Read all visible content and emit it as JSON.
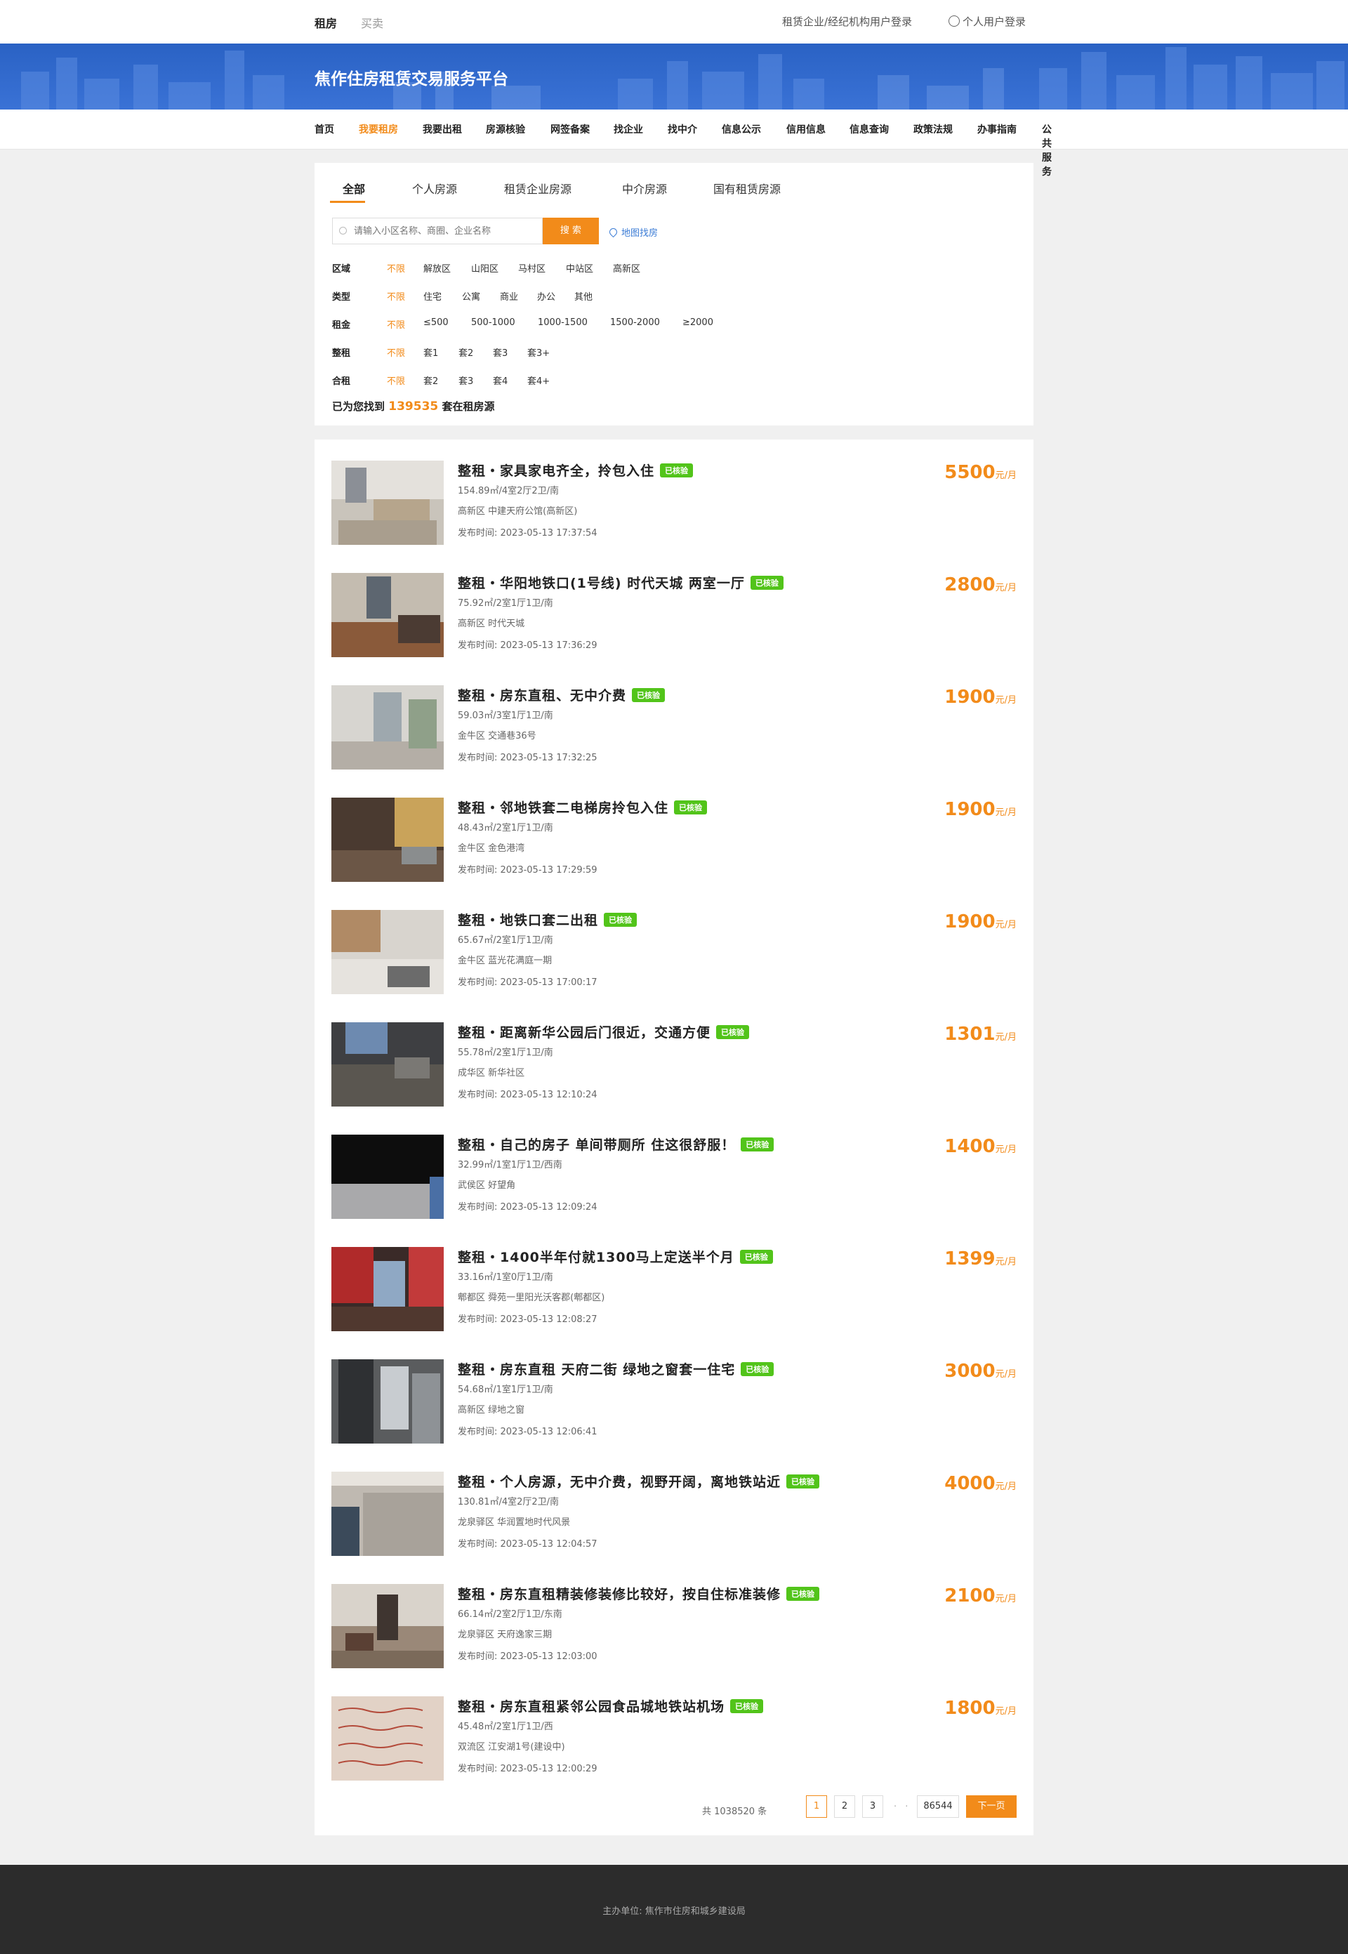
{
  "topbar": {
    "tabs": [
      "租房",
      "买卖"
    ],
    "company_login": "租赁企业/经纪机构用户登录",
    "personal_login": "个人用户登录"
  },
  "banner": {
    "title": "焦作住房租赁交易服务平台"
  },
  "nav": {
    "items": [
      "首页",
      "我要租房",
      "我要出租",
      "房源核验",
      "网签备案",
      "找企业",
      "找中介",
      "信息公示",
      "信用信息",
      "信息查询",
      "政策法规",
      "办事指南",
      "公共服务"
    ],
    "active": "我要租房"
  },
  "filter": {
    "tabs": [
      "全部",
      "个人房源",
      "租赁企业房源",
      "中介房源",
      "国有租赁房源"
    ],
    "active_tab": "全部",
    "search_placeholder": "请输入小区名称、商圈、企业名称",
    "search_button": "搜 索",
    "map_link": "地图找房",
    "rows": [
      {
        "label": "区域",
        "options": [
          "不限",
          "解放区",
          "山阳区",
          "马村区",
          "中站区",
          "高新区"
        ]
      },
      {
        "label": "类型",
        "options": [
          "不限",
          "住宅",
          "公寓",
          "商业",
          "办公",
          "其他"
        ]
      },
      {
        "label": "租金",
        "options": [
          "不限",
          "≤500",
          "500-1000",
          "1000-1500",
          "1500-2000",
          "≥2000"
        ]
      },
      {
        "label": "整租",
        "options": [
          "不限",
          "套1",
          "套2",
          "套3",
          "套3+"
        ]
      },
      {
        "label": "合租",
        "options": [
          "不限",
          "套2",
          "套3",
          "套4",
          "套4+"
        ]
      }
    ],
    "selected": "不限",
    "result_prefix": "已为您找到",
    "result_count": "139535",
    "result_suffix": "套在租房源"
  },
  "listings": [
    {
      "title": "整租・家具家电齐全，拎包入住",
      "badge": "已核验",
      "spec": "154.89㎡/4室2厅2卫/南",
      "location": "高新区 中建天府公馆(高新区)",
      "time": "发布时间: 2023-05-13 17:37:54",
      "price": "5500",
      "unit": "元/月"
    },
    {
      "title": "整租・华阳地铁口(1号线) 时代天城 两室一厅",
      "badge": "已核验",
      "spec": "75.92㎡/2室1厅1卫/南",
      "location": "高新区 时代天城",
      "time": "发布时间: 2023-05-13 17:36:29",
      "price": "2800",
      "unit": "元/月"
    },
    {
      "title": "整租・房东直租、无中介费",
      "badge": "已核验",
      "spec": "59.03㎡/3室1厅1卫/南",
      "location": "金牛区 交通巷36号",
      "time": "发布时间: 2023-05-13 17:32:25",
      "price": "1900",
      "unit": "元/月"
    },
    {
      "title": "整租・邻地铁套二电梯房拎包入住",
      "badge": "已核验",
      "spec": "48.43㎡/2室1厅1卫/南",
      "location": "金牛区 金色港湾",
      "time": "发布时间: 2023-05-13 17:29:59",
      "price": "1900",
      "unit": "元/月"
    },
    {
      "title": "整租・地铁口套二出租",
      "badge": "已核验",
      "spec": "65.67㎡/2室1厅1卫/南",
      "location": "金牛区 蓝光花满庭一期",
      "time": "发布时间: 2023-05-13 17:00:17",
      "price": "1900",
      "unit": "元/月"
    },
    {
      "title": "整租・距离新华公园后门很近，交通方便",
      "badge": "已核验",
      "spec": "55.78㎡/2室1厅1卫/南",
      "location": "成华区 新华社区",
      "time": "发布时间: 2023-05-13 12:10:24",
      "price": "1301",
      "unit": "元/月"
    },
    {
      "title": "整租・自己的房子 单间带厕所 住这很舒服！",
      "badge": "已核验",
      "spec": "32.99㎡/1室1厅1卫/西南",
      "location": "武侯区 好望角",
      "time": "发布时间: 2023-05-13 12:09:24",
      "price": "1400",
      "unit": "元/月"
    },
    {
      "title": "整租・1400半年付就1300马上定送半个月",
      "badge": "已核验",
      "spec": "33.16㎡/1室0厅1卫/南",
      "location": "郫都区 舜苑一里阳光沃客郡(郫都区)",
      "time": "发布时间: 2023-05-13 12:08:27",
      "price": "1399",
      "unit": "元/月"
    },
    {
      "title": "整租・房东直租 天府二街 绿地之窗套一住宅",
      "badge": "已核验",
      "spec": "54.68㎡/1室1厅1卫/南",
      "location": "高新区 绿地之窗",
      "time": "发布时间: 2023-05-13 12:06:41",
      "price": "3000",
      "unit": "元/月"
    },
    {
      "title": "整租・个人房源，无中介费，视野开阔，离地铁站近",
      "badge": "已核验",
      "spec": "130.81㎡/4室2厅2卫/南",
      "location": "龙泉驿区 华润置地时代风景",
      "time": "发布时间: 2023-05-13 12:04:57",
      "price": "4000",
      "unit": "元/月"
    },
    {
      "title": "整租・房东直租精装修装修比较好，按自住标准装修",
      "badge": "已核验",
      "spec": "66.14㎡/2室2厅1卫/东南",
      "location": "龙泉驿区 天府逸家三期",
      "time": "发布时间: 2023-05-13 12:03:00",
      "price": "2100",
      "unit": "元/月"
    },
    {
      "title": "整租・房东直租紧邻公园食品城地铁站机场",
      "badge": "已核验",
      "spec": "45.48㎡/2室1厅1卫/西",
      "location": "双流区 江安湖1号(建设中)",
      "time": "发布时间: 2023-05-13 12:00:29",
      "price": "1800",
      "unit": "元/月"
    }
  ],
  "pagination": {
    "total": "共 1038520 条",
    "pages": [
      "1",
      "2",
      "3"
    ],
    "dots": "· · ·",
    "last": "86544",
    "next": "下一页",
    "current": "1"
  },
  "footer": {
    "text": "主办单位:  焦作市住房和城乡建设局"
  },
  "colors": {
    "accent": "#f28b1a",
    "brand_blue": "#2a62c4",
    "verified": "#52c41a"
  }
}
